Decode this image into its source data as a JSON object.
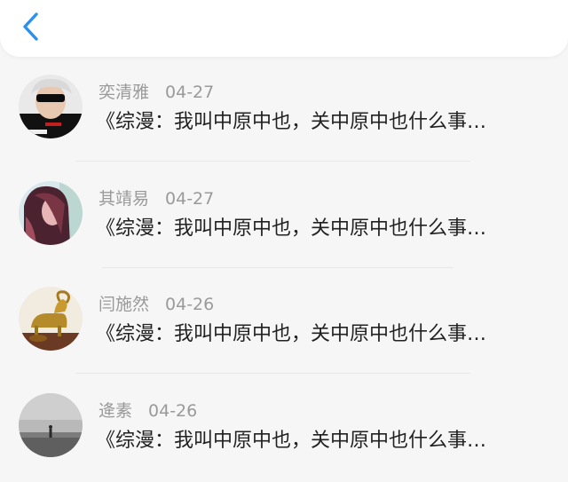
{
  "header": {
    "back_icon": "chevron-left-icon",
    "accent_color": "#2d8ff0"
  },
  "comments": [
    {
      "name": "奕清雅",
      "date": "04-27",
      "text": "《综漫：我叫中原中也，关中原中也什么事…",
      "avatar": "sunglasses-person-avatar"
    },
    {
      "name": "其靖易",
      "date": "04-27",
      "text": "《综漫：我叫中原中也，关中原中也什么事…",
      "avatar": "long-hair-girl-avatar"
    },
    {
      "name": "闫施然",
      "date": "04-26",
      "text": "《综漫：我叫中原中也，关中原中也什么事…",
      "avatar": "golden-goat-figurine-avatar"
    },
    {
      "name": "逄素",
      "date": "04-26",
      "text": "《综漫：我叫中原中也，关中原中也什么事…",
      "avatar": "foggy-walker-avatar"
    }
  ]
}
